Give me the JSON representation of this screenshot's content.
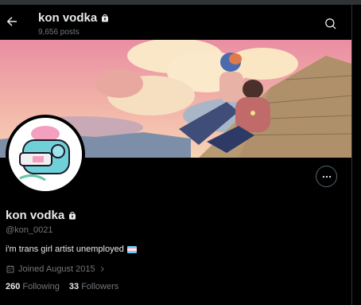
{
  "header": {
    "name": "kon vodka",
    "posts": "9,656 posts"
  },
  "profile": {
    "name": "kon vodka",
    "handle": "@kon_0021",
    "bio": "i'm trans girl artist unemployed",
    "joined": "Joined August 2015",
    "following_count": "260",
    "following_label": "Following",
    "followers_count": "33",
    "followers_label": "Followers"
  },
  "icons": {
    "back": "arrow-left-icon",
    "search": "search-icon",
    "lock": "lock-icon",
    "more": "more-icon",
    "calendar": "calendar-icon",
    "chevron": "chevron-right-icon",
    "flag": "trans-flag-icon"
  },
  "colors": {
    "background": "#000000",
    "text": "#e7e9ea",
    "muted": "#71767b",
    "flag_blue": "#5bcefa",
    "flag_pink": "#f5a9b8",
    "flag_white": "#ffffff"
  }
}
